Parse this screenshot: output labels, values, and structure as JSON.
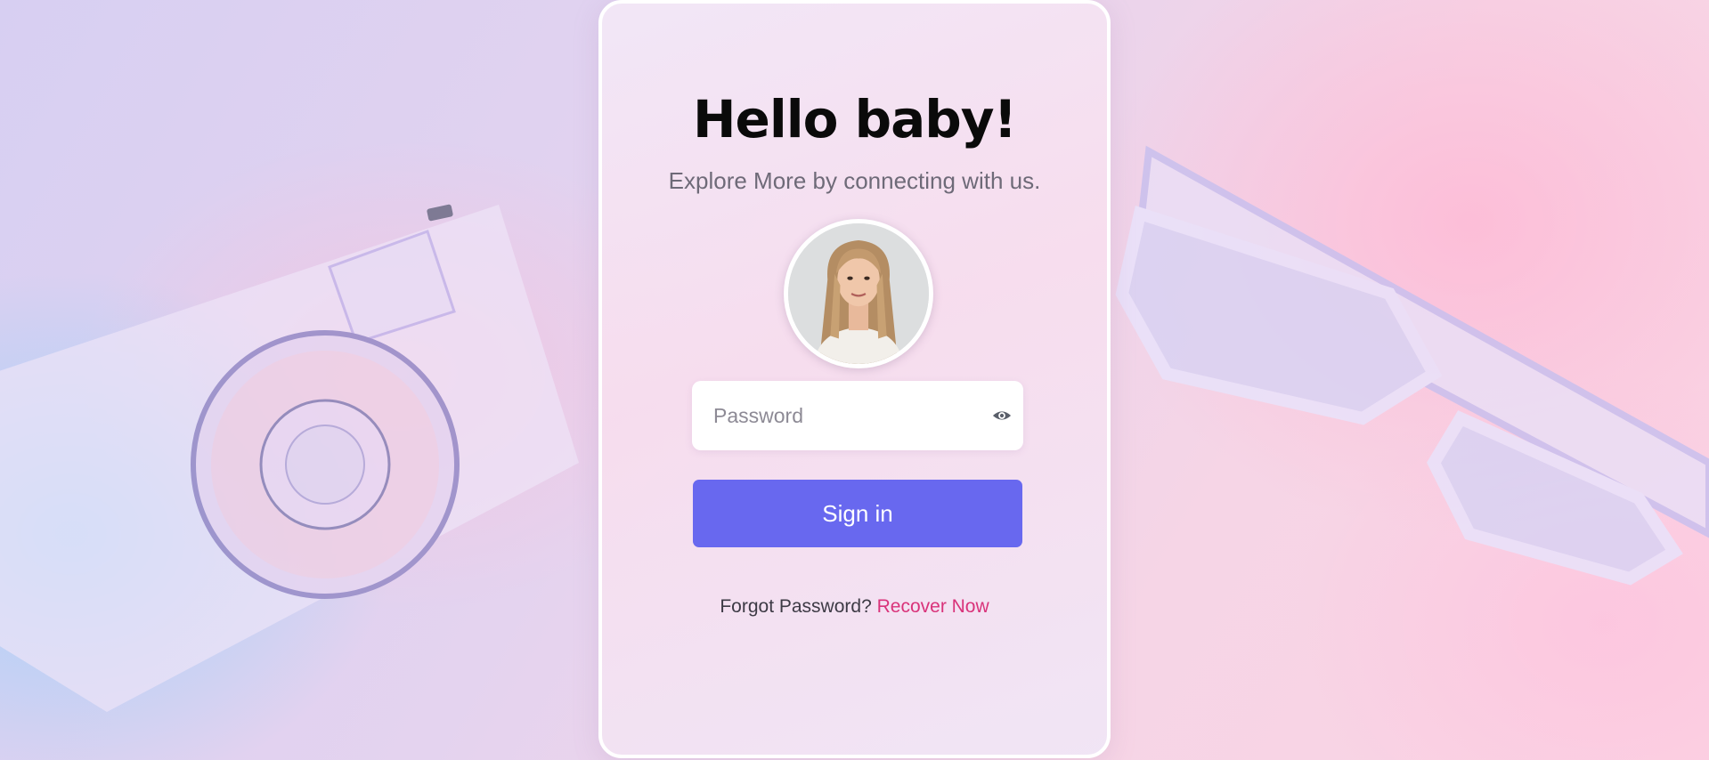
{
  "card": {
    "title": "Hello baby!",
    "subtitle": "Explore More by connecting with us."
  },
  "avatar": {
    "icon": "user-avatar-photo"
  },
  "password": {
    "placeholder": "Password",
    "value": "",
    "toggle_icon": "eye-icon"
  },
  "signin": {
    "label": "Sign in"
  },
  "forgot": {
    "text": "Forgot Password?",
    "link": "Recover Now"
  },
  "colors": {
    "accent": "#6868ef",
    "link": "#d9337a",
    "title": "#0a0a0a"
  }
}
